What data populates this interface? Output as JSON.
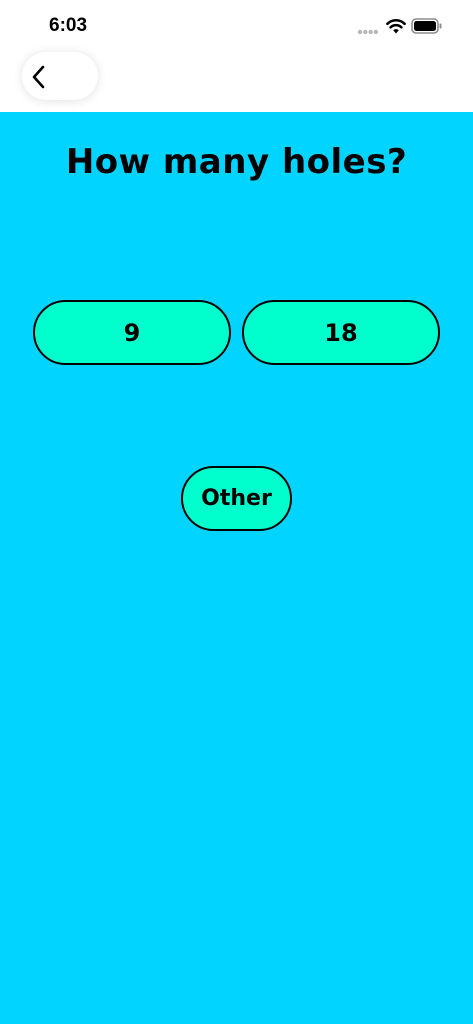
{
  "status_bar": {
    "time": "6:03"
  },
  "nav": {
    "back_icon": "chevron-left-icon"
  },
  "question": {
    "title": "How many holes?"
  },
  "options": {
    "nine": "9",
    "eighteen": "18",
    "other": "Other"
  },
  "colors": {
    "background": "#00d4ff",
    "button": "#00ffcc",
    "border": "#000000",
    "header": "#ffffff"
  }
}
